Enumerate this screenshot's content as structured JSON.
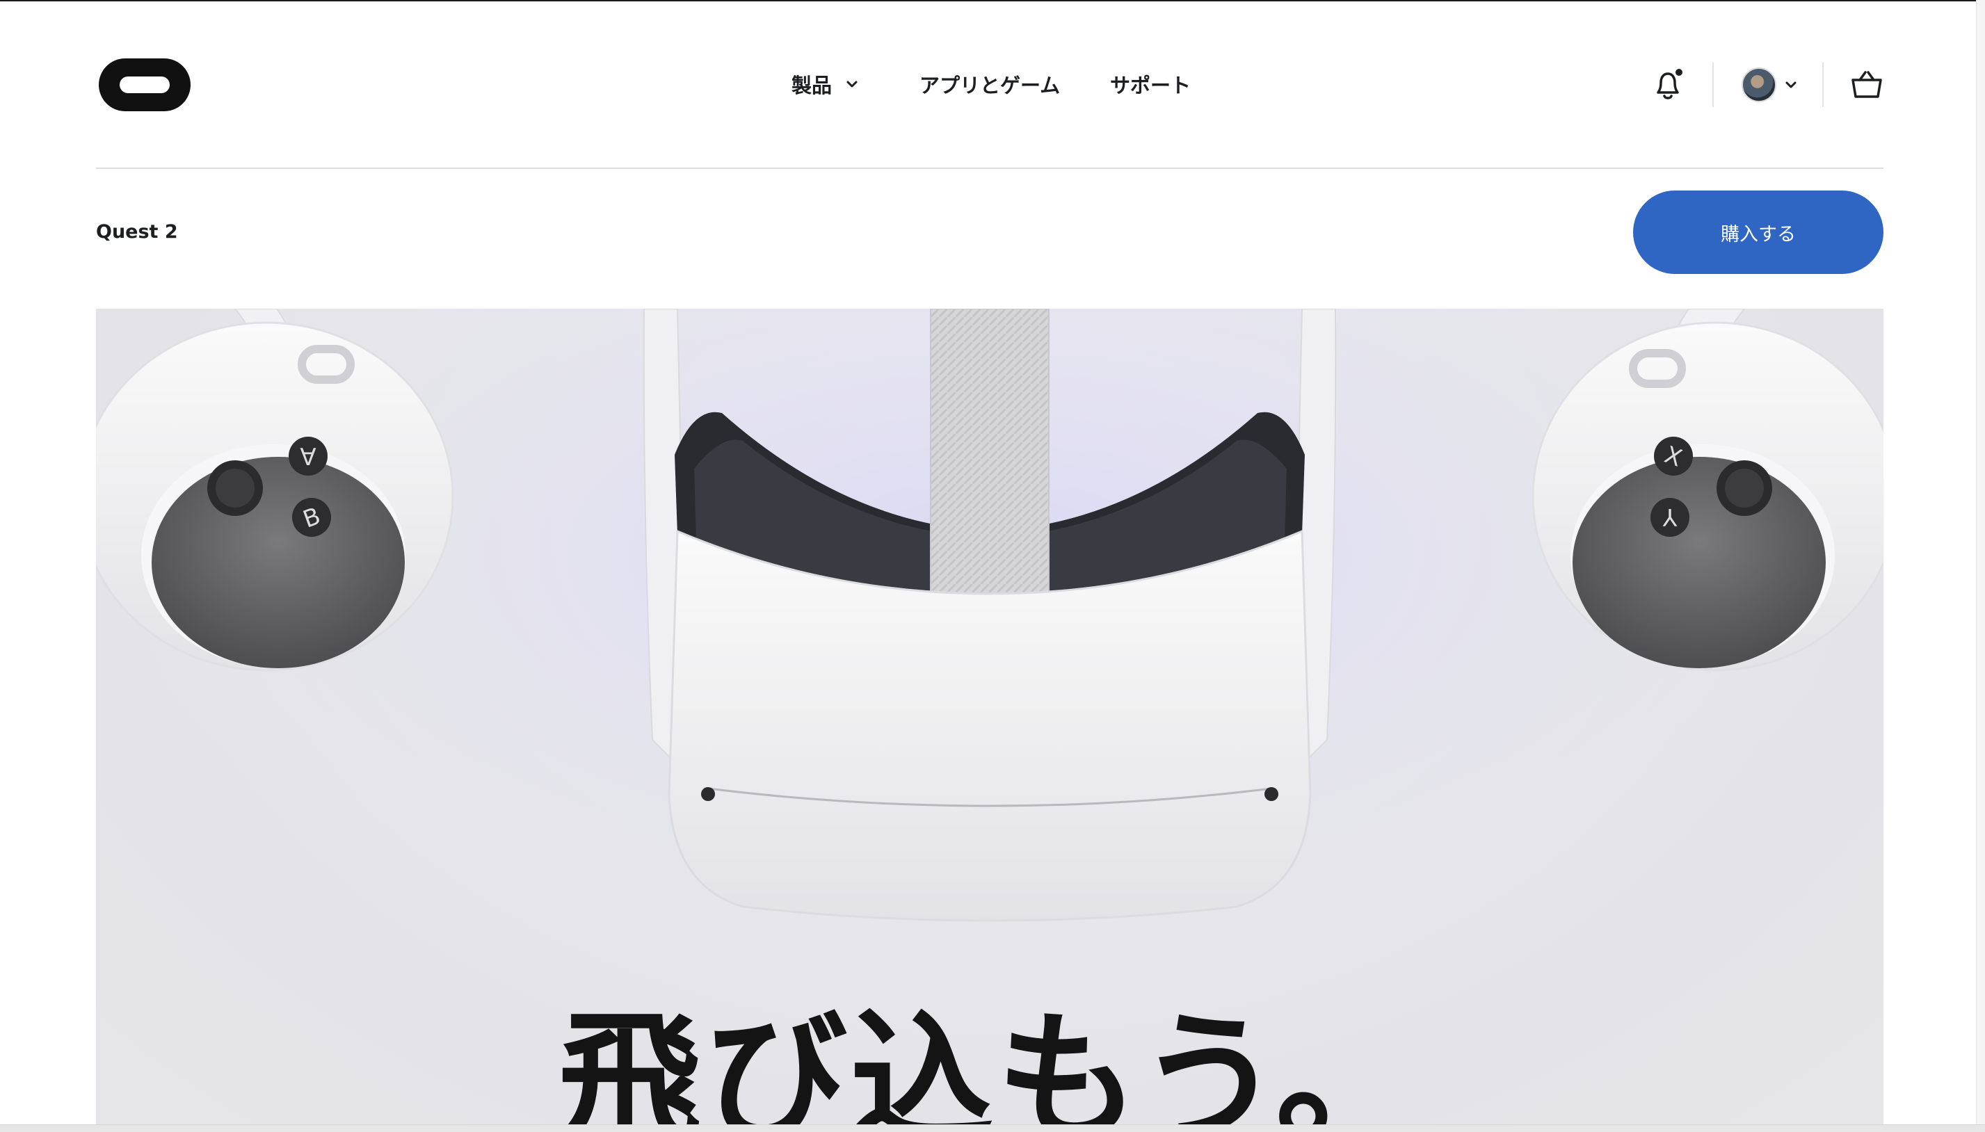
{
  "header": {
    "nav": [
      {
        "label": "製品",
        "has_dropdown": true
      },
      {
        "label": "アプリとゲーム",
        "has_dropdown": false
      },
      {
        "label": "サポート",
        "has_dropdown": false
      }
    ],
    "icons": {
      "notifications": "bell-icon",
      "account": "avatar",
      "cart": "cart-icon"
    }
  },
  "product_bar": {
    "title": "Quest 2",
    "buy_label": "購入する"
  },
  "hero": {
    "headline": "飛び込もう。"
  },
  "colors": {
    "accent": "#2f65c3",
    "text": "#1c1e21",
    "hero_bg": "#e6e6ea"
  }
}
